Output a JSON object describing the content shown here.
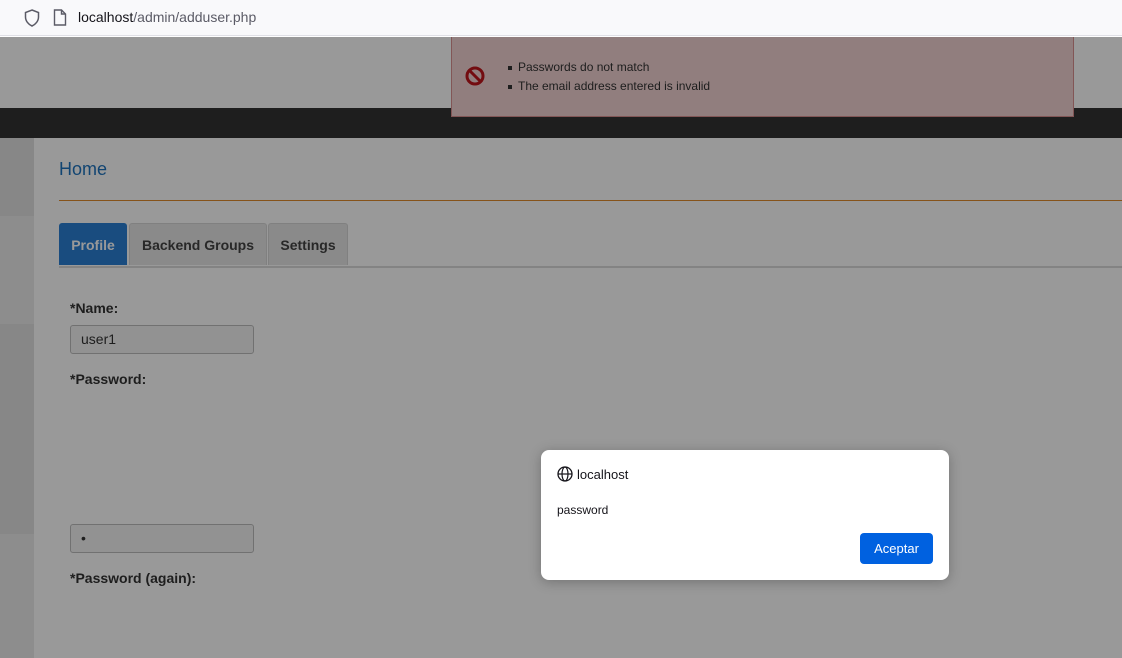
{
  "browser": {
    "url_host": "localhost",
    "url_path": "/admin/adduser.php"
  },
  "errors": {
    "messages": [
      "Passwords do not match",
      "The email address entered is invalid"
    ]
  },
  "breadcrumb": {
    "home": "Home"
  },
  "tabs": [
    {
      "label": "Profile",
      "active": true
    },
    {
      "label": "Backend Groups",
      "active": false
    },
    {
      "label": "Settings",
      "active": false
    }
  ],
  "form": {
    "name_label": "*Name:",
    "name_value": "user1",
    "password_label": "*Password:",
    "password_value": "•",
    "password_again_label": "*Password (again):"
  },
  "dialog": {
    "origin": "localhost",
    "message": "password",
    "ok_label": "Aceptar"
  },
  "colors": {
    "accent": "#2a7fd4",
    "error_bg": "#f2d3d3",
    "dialog_button": "#0061e0"
  }
}
